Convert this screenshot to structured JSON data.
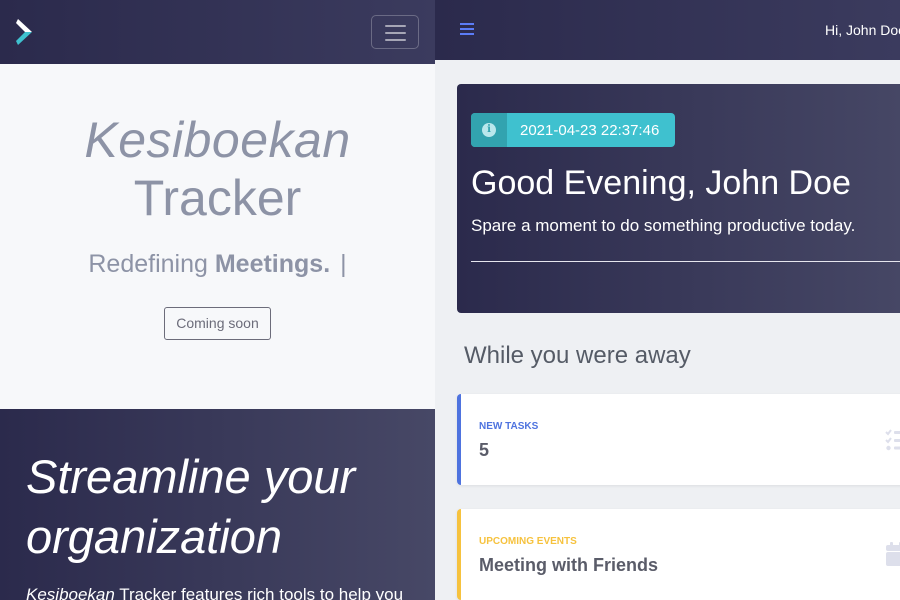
{
  "left": {
    "hero": {
      "title_line1": "Kesiboekan",
      "title_line2": "Tracker",
      "subtitle_prefix": "Redefining ",
      "subtitle_bold": "Meetings.",
      "cursor": "|",
      "button": "Coming soon"
    },
    "feature": {
      "title": "Streamline your organization",
      "text_italic": "Kesiboekan",
      "text_rest": " Tracker features rich tools to help you"
    }
  },
  "right": {
    "topbar": {
      "greeting": "Hi, John Doe"
    },
    "welcome": {
      "timestamp": "2021-04-23 22:37:46",
      "title": "Good Evening, John Doe",
      "subtitle": "Spare a moment to do something productive today."
    },
    "section_title": "While you were away",
    "cards": [
      {
        "label": "New Tasks",
        "value": "5"
      },
      {
        "label": "Upcoming Events",
        "value": "Meeting with Friends"
      }
    ]
  },
  "colors": {
    "navy": "#2b2a4c",
    "info": "#3fc1cf",
    "primary": "#4e73df",
    "warning": "#f6c23e"
  }
}
